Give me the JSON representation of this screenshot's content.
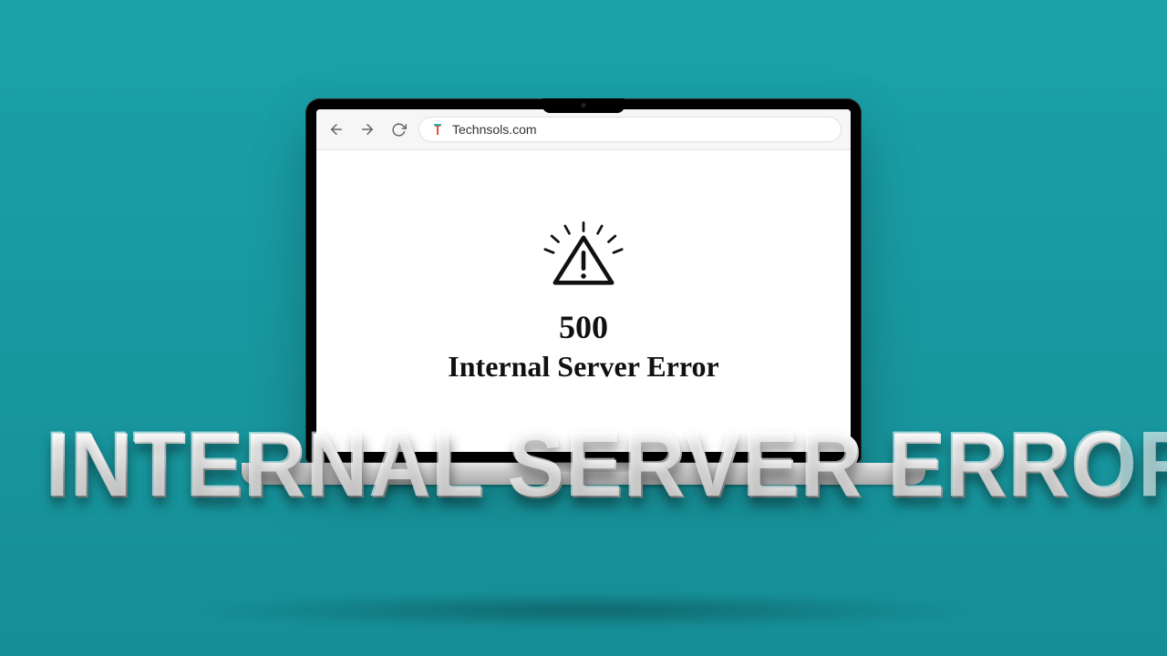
{
  "browser": {
    "url": "Technsols.com",
    "favicon_name": "site-favicon"
  },
  "page": {
    "error_code": "500",
    "error_message": "Internal Server Error"
  },
  "hero": {
    "headline": "INTERNAL SERVER ERROR"
  }
}
